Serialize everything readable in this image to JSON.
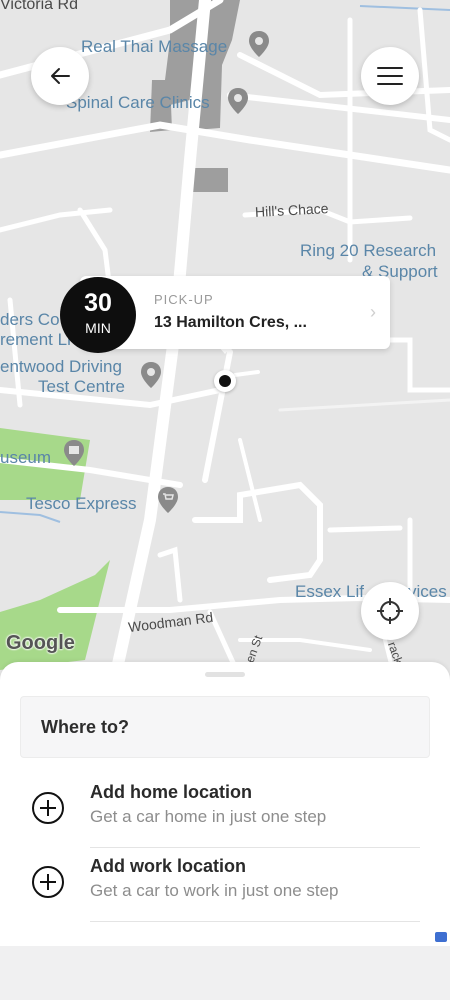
{
  "map": {
    "labels": {
      "victoria_rd": "Victoria Rd",
      "real_thai": "Real Thai Massage",
      "spinal_care": "Spinal Care Clinics",
      "hills_chace": "Hill's Chace",
      "ring20": "Ring 20 Research",
      "ring20_line2": "& Support",
      "ders_co": "ders Co",
      "rement_li": "rement Li",
      "brentwood": "entwood Driving",
      "brentwood_line2": "Test Centre",
      "museum": "useum",
      "tesco": "Tesco Express",
      "essex": "Essex Lif",
      "essex_tail": "vices",
      "woodman": "Woodman Rd",
      "en_st": "en St",
      "track": "rack"
    },
    "google_logo": "Google"
  },
  "header": {
    "back_icon": "arrow-left-icon",
    "menu_icon": "hamburger-icon"
  },
  "pickup": {
    "eta_value": "30",
    "eta_unit": "MIN",
    "label": "PICK-UP",
    "address": "13 Hamilton Cres, ...",
    "chevron": "›"
  },
  "locate_icon": "crosshair-icon",
  "sheet": {
    "where_to": "Where to?",
    "rows": [
      {
        "title": "Add home location",
        "subtitle": "Get a car home in just one step"
      },
      {
        "title": "Add work location",
        "subtitle": "Get a car to work in just one step"
      }
    ]
  },
  "colors": {
    "map_bg": "#e6e6e6",
    "road": "#ffffff",
    "park": "#a7d98a",
    "building": "#9e9e9e",
    "poi_text": "#5a86a8",
    "accent_dark": "#0e0e0e"
  }
}
